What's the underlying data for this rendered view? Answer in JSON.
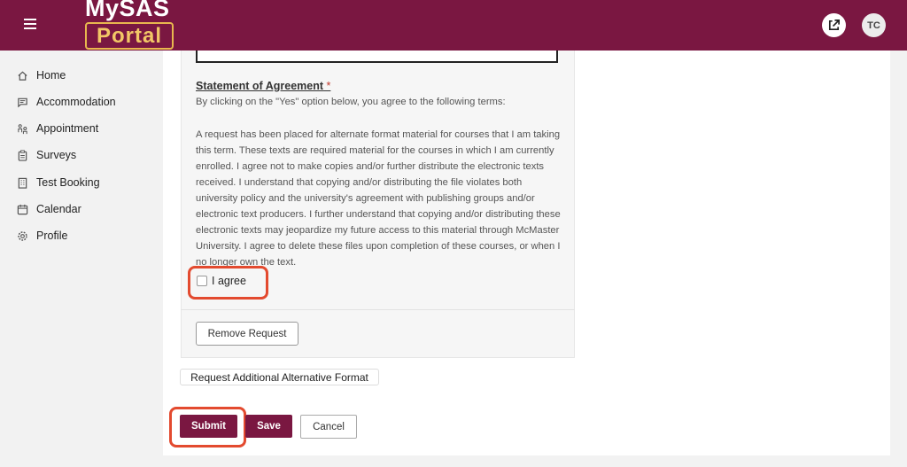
{
  "header": {
    "logo_top": "MySAS",
    "logo_bottom": "Portal",
    "avatar_initials": "TC",
    "bg_color": "#7a1741",
    "logo_accent": "#e8b74e"
  },
  "sidebar": {
    "items": [
      {
        "label": "Home",
        "icon": "home-icon"
      },
      {
        "label": "Accommodation",
        "icon": "chat-icon"
      },
      {
        "label": "Appointment",
        "icon": "people-icon"
      },
      {
        "label": "Surveys",
        "icon": "clipboard-icon"
      },
      {
        "label": "Test Booking",
        "icon": "building-icon"
      },
      {
        "label": "Calendar",
        "icon": "calendar-icon"
      },
      {
        "label": "Profile",
        "icon": "gear-icon"
      }
    ]
  },
  "statement": {
    "title": "Statement of Agreement",
    "required_mark": "*",
    "intro": "By clicking on the \"Yes\" option below, you agree to the following terms:",
    "body": "A request has been placed for alternate format material for courses that I am taking this term. These texts are required material for the courses in which I am currently enrolled. I agree not to make copies and/or further distribute the electronic texts received. I understand that copying and/or distributing the file violates both university policy and the university's agreement with publishing groups and/or electronic text producers. I further understand that copying and/or distributing these electronic texts may jeopardize my future access to this material through McMaster University. I agree to delete these files upon completion of these courses, or when I no longer own the text.",
    "agree_label": "I agree",
    "agree_checked": false
  },
  "actions": {
    "remove_request": "Remove Request",
    "request_additional": "Request Additional Alternative Format",
    "submit": "Submit",
    "save": "Save",
    "cancel": "Cancel",
    "highlight_color": "#e34a2f"
  }
}
